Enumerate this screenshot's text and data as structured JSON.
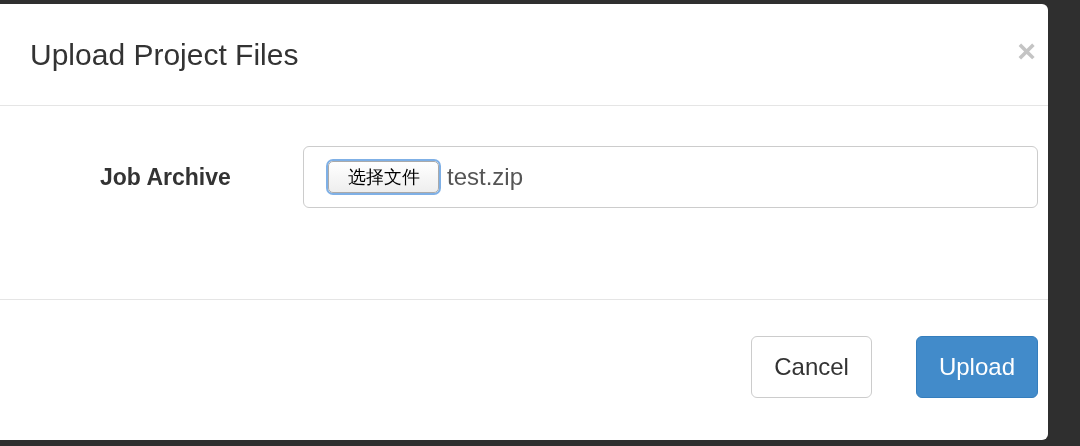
{
  "dialog": {
    "title": "Upload Project Files",
    "close": "×",
    "fields": [
      {
        "label": "Job Archive",
        "button": "选择文件",
        "value": "test.zip"
      }
    ],
    "buttons": [
      {
        "label": "Cancel",
        "kind": "default"
      },
      {
        "label": "Upload",
        "kind": "primary"
      }
    ]
  }
}
